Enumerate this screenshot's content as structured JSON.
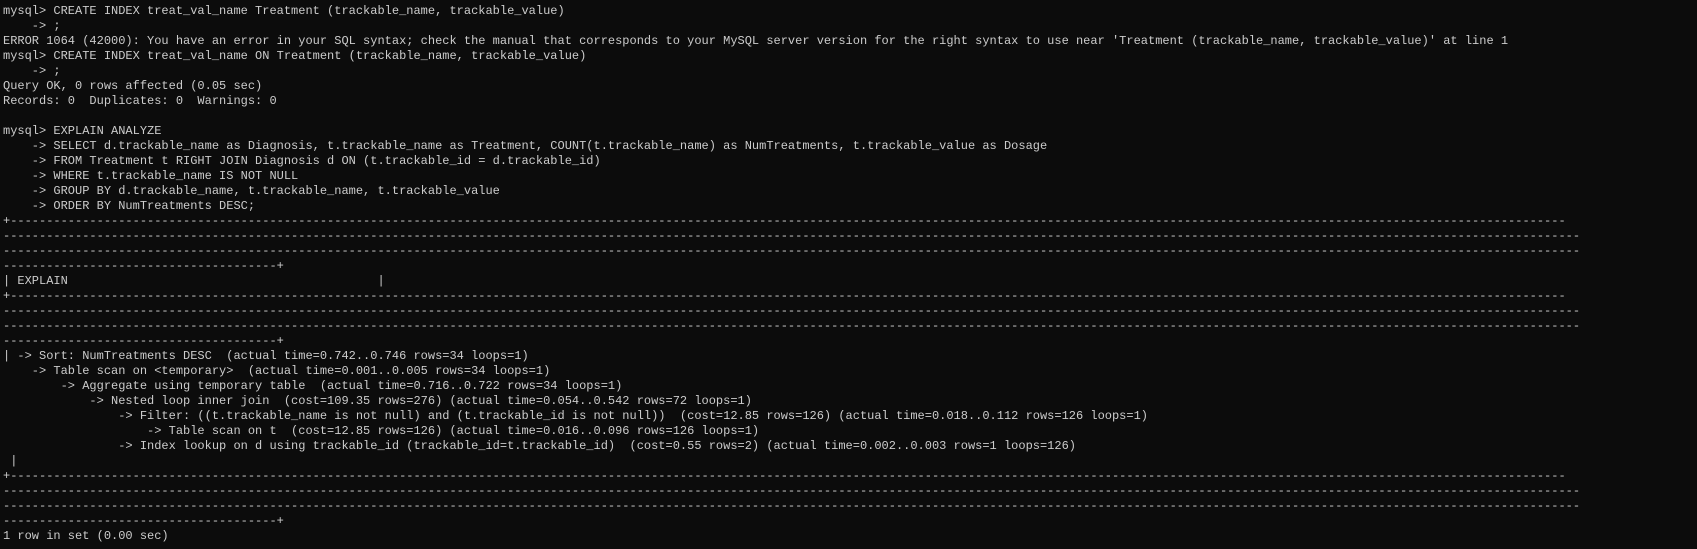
{
  "terminal": {
    "colors": {
      "background": "#0c0c0c",
      "text": "#cccccc"
    },
    "lines": [
      "mysql> CREATE INDEX treat_val_name Treatment (trackable_name, trackable_value)",
      "    -> ;",
      "ERROR 1064 (42000): You have an error in your SQL syntax; check the manual that corresponds to your MySQL server version for the right syntax to use near 'Treatment (trackable_name, trackable_value)' at line 1",
      "mysql> CREATE INDEX treat_val_name ON Treatment (trackable_name, trackable_value)",
      "    -> ;",
      "Query OK, 0 rows affected (0.05 sec)",
      "Records: 0  Duplicates: 0  Warnings: 0",
      "",
      "mysql> EXPLAIN ANALYZE",
      "    -> SELECT d.trackable_name as Diagnosis, t.trackable_name as Treatment, COUNT(t.trackable_name) as NumTreatments, t.trackable_value as Dosage",
      "    -> FROM Treatment t RIGHT JOIN Diagnosis d ON (t.trackable_id = d.trackable_id)",
      "    -> WHERE t.trackable_name IS NOT NULL",
      "    -> GROUP BY d.trackable_name, t.trackable_name, t.trackable_value",
      "    -> ORDER BY NumTreatments DESC;",
      "+------------------------------------------------------------------------------------------------------------------------------------------------------------------------------------------------------------------------",
      "---------------------------------------------------------------------------------------------------------------------------------------------------------------------------------------------------------------------------",
      "---------------------------------------------------------------------------------------------------------------------------------------------------------------------------------------------------------------------------",
      "--------------------------------------+",
      "| EXPLAIN                                           |",
      "+------------------------------------------------------------------------------------------------------------------------------------------------------------------------------------------------------------------------",
      "---------------------------------------------------------------------------------------------------------------------------------------------------------------------------------------------------------------------------",
      "---------------------------------------------------------------------------------------------------------------------------------------------------------------------------------------------------------------------------",
      "--------------------------------------+",
      "| -> Sort: NumTreatments DESC  (actual time=0.742..0.746 rows=34 loops=1)",
      "    -> Table scan on <temporary>  (actual time=0.001..0.005 rows=34 loops=1)",
      "        -> Aggregate using temporary table  (actual time=0.716..0.722 rows=34 loops=1)",
      "            -> Nested loop inner join  (cost=109.35 rows=276) (actual time=0.054..0.542 rows=72 loops=1)",
      "                -> Filter: ((t.trackable_name is not null) and (t.trackable_id is not null))  (cost=12.85 rows=126) (actual time=0.018..0.112 rows=126 loops=1)",
      "                    -> Table scan on t  (cost=12.85 rows=126) (actual time=0.016..0.096 rows=126 loops=1)",
      "                -> Index lookup on d using trackable_id (trackable_id=t.trackable_id)  (cost=0.55 rows=2) (actual time=0.002..0.003 rows=1 loops=126)",
      " |",
      "+------------------------------------------------------------------------------------------------------------------------------------------------------------------------------------------------------------------------",
      "---------------------------------------------------------------------------------------------------------------------------------------------------------------------------------------------------------------------------",
      "---------------------------------------------------------------------------------------------------------------------------------------------------------------------------------------------------------------------------",
      "--------------------------------------+",
      "1 row in set (0.00 sec)"
    ]
  }
}
